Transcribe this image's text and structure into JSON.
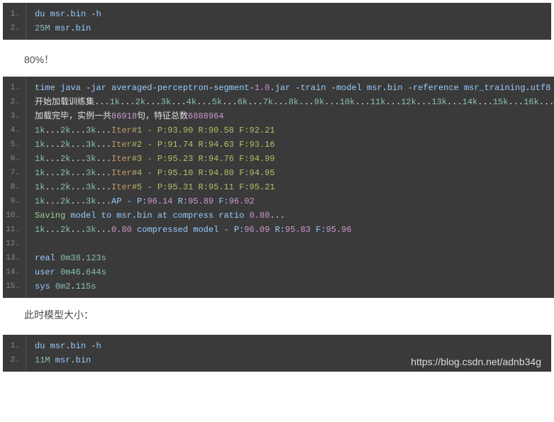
{
  "block1": {
    "l1_a": "du msr",
    "l1_b": ".",
    "l1_c": "bin ",
    "l1_d": "-",
    "l1_e": "h",
    "l2_a": "25M",
    "l2_b": "     msr",
    "l2_c": ".",
    "l2_d": "bin"
  },
  "para1": "80%！",
  "block2": {
    "l1_a": "time java ",
    "l1_b": "-",
    "l1_c": "jar averaged",
    "l1_d": "-",
    "l1_e": "perceptron",
    "l1_f": "-",
    "l1_g": "segment",
    "l1_h": "-",
    "l1_i": "1.0",
    "l1_j": ".",
    "l1_k": "jar ",
    "l1_l": "-",
    "l1_m": "train ",
    "l1_n": "-",
    "l1_o": "model msr",
    "l1_p": ".",
    "l1_q": "bin ",
    "l1_r": "-",
    "l1_s": "reference msr_training",
    "l1_t": ".",
    "l1_u": "utf8 ",
    "l1_v": "-",
    "l2_a": "开始加载训练集",
    "l2_b": "...",
    "l2_c": "1k",
    "l2_d": "...",
    "l2_e": "2k",
    "l2_f": "...",
    "l2_g": "3k",
    "l2_h": "...",
    "l2_i": "4k",
    "l2_j": "...",
    "l2_k": "5k",
    "l2_l": "...",
    "l2_m": "6k",
    "l2_n": "...",
    "l2_o": "7k",
    "l2_p": "...",
    "l2_q": "8k",
    "l2_r": "...",
    "l2_s": "9k",
    "l2_t": "...",
    "l2_u": "10k",
    "l2_v": "...",
    "l2_w": "11k",
    "l2_x": "...",
    "l2_y": "12k",
    "l2_z": "...",
    "l2_aa": "13k",
    "l2_ab": "...",
    "l2_ac": "14k",
    "l2_ad": "...",
    "l2_ae": "15k",
    "l2_af": "...",
    "l2_ag": "16k",
    "l2_ah": "...",
    "l3_a": "加载完毕，实例一共",
    "l3_b": "86918",
    "l3_c": "句，特征总数",
    "l3_d": "6888964",
    "l4_a": "1k",
    "l4_b": "...",
    "l4_c": "2k",
    "l4_d": "...",
    "l4_e": "3k",
    "l4_f": "...",
    "l4_g": "Iter",
    "l4_h": "#1 - P:93.90 R:90.58 F:92.21",
    "l5_a": "1k",
    "l5_b": "...",
    "l5_c": "2k",
    "l5_d": "...",
    "l5_e": "3k",
    "l5_f": "...",
    "l5_g": "Iter",
    "l5_h": "#2 - P:91.74 R:94.63 F:93.16",
    "l6_a": "1k",
    "l6_b": "...",
    "l6_c": "2k",
    "l6_d": "...",
    "l6_e": "3k",
    "l6_f": "...",
    "l6_g": "Iter",
    "l6_h": "#3 - P:95.23 R:94.76 F:94.99",
    "l7_a": "1k",
    "l7_b": "...",
    "l7_c": "2k",
    "l7_d": "...",
    "l7_e": "3k",
    "l7_f": "...",
    "l7_g": "Iter",
    "l7_h": "#4 - P:95.10 R:94.80 F:94.95",
    "l8_a": "1k",
    "l8_b": "...",
    "l8_c": "2k",
    "l8_d": "...",
    "l8_e": "3k",
    "l8_f": "...",
    "l8_g": "Iter",
    "l8_h": "#5 - P:95.31 R:95.11 F:95.21",
    "l9_a": "1k",
    "l9_b": "...",
    "l9_c": "2k",
    "l9_d": "...",
    "l9_e": "3k",
    "l9_f": "...",
    "l9_g": "AP",
    "l9_h": " - P:",
    "l9_i": "96.14",
    "l9_j": " R:",
    "l9_k": "95.89",
    "l9_l": " F:",
    "l9_m": "96.02",
    "l10_a": "Saving",
    "l10_b": " model to msr",
    "l10_c": ".",
    "l10_d": "bin at compress ratio ",
    "l10_e": "0.80",
    "l10_f": "...",
    "l11_a": "1k",
    "l11_b": "...",
    "l11_c": "2k",
    "l11_d": "...",
    "l11_e": "3k",
    "l11_f": "...",
    "l11_g": "0.80",
    "l11_h": " compressed model - P:",
    "l11_i": "96.09",
    "l11_j": " R:",
    "l11_k": "95.83",
    "l11_l": " F:",
    "l11_m": "95.96",
    "l13_a": "real    ",
    "l13_b": "0m38",
    "l13_c": ".",
    "l13_d": "123s",
    "l14_a": "user    ",
    "l14_b": "0m46",
    "l14_c": ".",
    "l14_d": "644s",
    "l15_a": "sys     ",
    "l15_b": "0m2",
    "l15_c": ".",
    "l15_d": "115s"
  },
  "para2": "此时模型大小：",
  "block3": {
    "l1_a": "du msr",
    "l1_b": ".",
    "l1_c": "bin ",
    "l1_d": "-",
    "l1_e": "h",
    "l2_a": "11M",
    "l2_b": "     msr",
    "l2_c": ".",
    "l2_d": "bin"
  },
  "watermark": "https://blog.csdn.net/adnb34g"
}
